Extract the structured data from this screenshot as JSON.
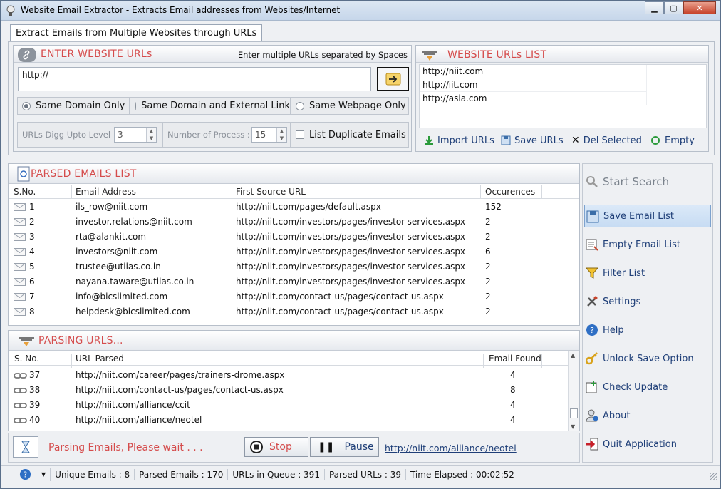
{
  "window": {
    "title": "Website Email Extractor - Extracts Email addresses from Websites/Internet"
  },
  "tab": {
    "label": "Extract Emails from Multiple Websites through URLs"
  },
  "urlEntry": {
    "title": "ENTER WEBSITE URLs",
    "hint": "Enter multiple URLs separated by Spaces",
    "value": "http://",
    "options": [
      "Same Domain Only",
      "Same Domain and External Link",
      "Same Webpage Only"
    ],
    "digg_label": "URLs Digg Upto Level :",
    "digg_value": "3",
    "process_label": "Number of Process :",
    "process_value": "15",
    "duplicate_label": "List Duplicate Emails"
  },
  "urlList": {
    "title": "WEBSITE URLs LIST",
    "items": [
      "http://niit.com",
      "http://iit.com",
      "http://asia.com"
    ],
    "buttons": {
      "import": "Import URLs",
      "save": "Save URLs",
      "del": "Del Selected",
      "empty": "Empty"
    }
  },
  "emails": {
    "title": "PARSED EMAILS LIST",
    "headers": {
      "sno": "S.No.",
      "email": "Email Address",
      "source": "First Source URL",
      "occ": "Occurences"
    },
    "rows": [
      {
        "sno": "1",
        "email": "ils_row@niit.com",
        "source": "http://niit.com/pages/default.aspx",
        "occ": "152"
      },
      {
        "sno": "2",
        "email": "investor.relations@niit.com",
        "source": "http://niit.com/investors/pages/investor-services.aspx",
        "occ": "2"
      },
      {
        "sno": "3",
        "email": "rta@alankit.com",
        "source": "http://niit.com/investors/pages/investor-services.aspx",
        "occ": "2"
      },
      {
        "sno": "4",
        "email": "investors@niit.com",
        "source": "http://niit.com/investors/pages/investor-services.aspx",
        "occ": "6"
      },
      {
        "sno": "5",
        "email": "trustee@utiias.co.in",
        "source": "http://niit.com/investors/pages/investor-services.aspx",
        "occ": "2"
      },
      {
        "sno": "6",
        "email": "nayana.taware@utiias.co.in",
        "source": "http://niit.com/investors/pages/investor-services.aspx",
        "occ": "2"
      },
      {
        "sno": "7",
        "email": "info@bicslimited.com",
        "source": "http://niit.com/contact-us/pages/contact-us.aspx",
        "occ": "2"
      },
      {
        "sno": "8",
        "email": "helpdesk@bicslimited.com",
        "source": "http://niit.com/contact-us/pages/contact-us.aspx",
        "occ": "2"
      }
    ]
  },
  "parsing": {
    "title": "PARSING URLS...",
    "headers": {
      "sno": "S. No.",
      "url": "URL Parsed",
      "found": "Email Found"
    },
    "rows": [
      {
        "sno": "37",
        "url": "http://niit.com/career/pages/trainers-drome.aspx",
        "found": "4"
      },
      {
        "sno": "38",
        "url": "http://niit.com/contact-us/pages/contact-us.aspx",
        "found": "8"
      },
      {
        "sno": "39",
        "url": "http://niit.com/alliance/ccit",
        "found": "4"
      },
      {
        "sno": "40",
        "url": "http://niit.com/alliance/neotel",
        "found": "4"
      }
    ]
  },
  "progress": {
    "status": "Parsing Emails, Please wait . . .",
    "stop": "Stop",
    "pause": "Pause",
    "current_url": "http://niit.com/alliance/neotel"
  },
  "sidebar": {
    "start": "Start Search",
    "save": "Save Email List",
    "empty": "Empty Email List",
    "filter": "Filter List",
    "settings": "Settings",
    "help": "Help",
    "unlock": "Unlock Save Option",
    "update": "Check Update",
    "about": "About",
    "quit": "Quit Application"
  },
  "statusbar": {
    "unique": "Unique Emails : 8",
    "parsed": "Parsed Emails : 170",
    "queue": "URLs in Queue : 391",
    "parsed_urls": "Parsed URLs : 39",
    "elapsed": "Time Elapsed : 00:02:52"
  },
  "colors": {
    "accent_red": "#d54c4c",
    "link_blue": "#1f3f78",
    "selected_bg": "#c7dcf3"
  }
}
